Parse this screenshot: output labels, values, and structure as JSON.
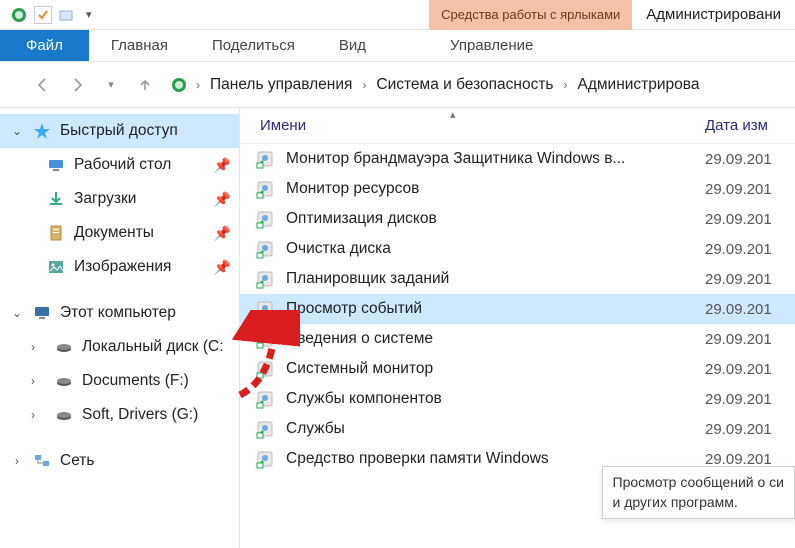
{
  "titlebar": {
    "context_tab": "Средства работы с ярлыками",
    "window_title": "Администрировани"
  },
  "ribbon": {
    "file": "Файл",
    "home": "Главная",
    "share": "Поделиться",
    "view": "Вид",
    "manage": "Управление"
  },
  "breadcrumb": {
    "items": [
      "Панель управления",
      "Система и безопасность",
      "Администрирова"
    ]
  },
  "sidebar": {
    "quick_access": "Быстрый доступ",
    "quick_children": [
      {
        "label": "Рабочий стол",
        "pinned": true,
        "icon": "desktop"
      },
      {
        "label": "Загрузки",
        "pinned": true,
        "icon": "downloads"
      },
      {
        "label": "Документы",
        "pinned": true,
        "icon": "documents"
      },
      {
        "label": "Изображения",
        "pinned": true,
        "icon": "pictures"
      }
    ],
    "this_pc": "Этот компьютер",
    "pc_children": [
      {
        "label": "Локальный диск (C:",
        "icon": "disk"
      },
      {
        "label": "Documents (F:)",
        "icon": "disk"
      },
      {
        "label": "Soft, Drivers (G:)",
        "icon": "disk"
      }
    ],
    "network": "Сеть"
  },
  "columns": {
    "name": "Имени",
    "date": "Дата изм"
  },
  "rows": [
    {
      "name": "Монитор брандмауэра Защитника Windows в...",
      "date": "29.09.201",
      "selected": false
    },
    {
      "name": "Монитор ресурсов",
      "date": "29.09.201",
      "selected": false
    },
    {
      "name": "Оптимизация дисков",
      "date": "29.09.201",
      "selected": false
    },
    {
      "name": "Очистка диска",
      "date": "29.09.201",
      "selected": false
    },
    {
      "name": "Планировщик заданий",
      "date": "29.09.201",
      "selected": false
    },
    {
      "name": "Просмотр событий",
      "date": "29.09.201",
      "selected": true
    },
    {
      "name": "Сведения о системе",
      "date": "29.09.201",
      "selected": false
    },
    {
      "name": "Системный монитор",
      "date": "29.09.201",
      "selected": false
    },
    {
      "name": "Службы компонентов",
      "date": "29.09.201",
      "selected": false
    },
    {
      "name": "Службы",
      "date": "29.09.201",
      "selected": false
    },
    {
      "name": "Средство проверки памяти Windows",
      "date": "29.09.201",
      "selected": false
    }
  ],
  "tooltip": {
    "line1": "Просмотр сообщений о си",
    "line2": "и других программ."
  }
}
